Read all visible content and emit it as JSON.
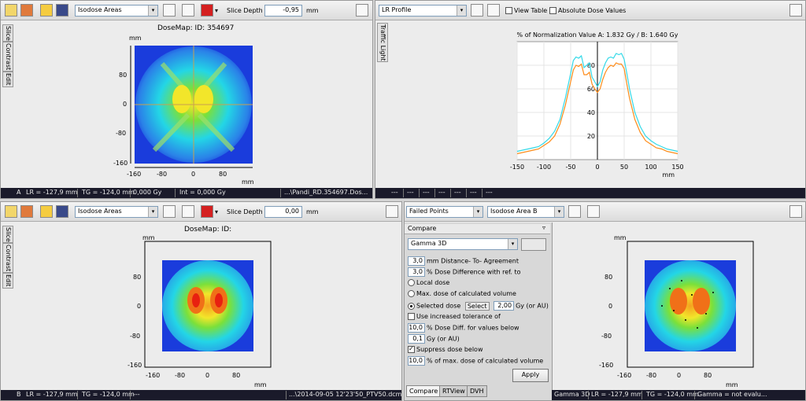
{
  "top_left": {
    "view_select": "Isodose Areas",
    "slice_depth_label": "Slice Depth",
    "slice_depth_value": "-0,95",
    "slice_depth_unit": "mm",
    "vtabs": [
      "Slice",
      "Contrast",
      "Edit"
    ],
    "map_title": "DoseMap: ID: 354697",
    "y_unit": "mm",
    "x_unit": "mm",
    "y_ticks": [
      "80",
      "0",
      "-80",
      "-160"
    ],
    "x_ticks": [
      "-160",
      "-80",
      "0",
      "80"
    ],
    "status": [
      "A",
      "LR = -127,9 mm",
      "TG = -124,0 mm",
      "0,000 Gy",
      "Int = 0,000 Gy",
      "...\\Pandi_RD.354697.Dos..."
    ]
  },
  "top_right": {
    "view_select": "LR Profile",
    "view_table": "View Table",
    "absolute_dose": "Absolute Dose Values",
    "vtab": "Traffic Light",
    "status": [
      "---",
      "---",
      "---",
      "---",
      "---",
      "---",
      "---"
    ]
  },
  "chart_data": {
    "type": "line",
    "title": "% of Normalization Value A: 1.832 Gy  / B: 1.640 Gy",
    "xlabel": "mm",
    "ylabel": "",
    "xlim": [
      -150,
      150
    ],
    "ylim": [
      0,
      100
    ],
    "x_ticks": [
      -150,
      -100,
      -50,
      0,
      50,
      100,
      150
    ],
    "y_ticks": [
      20,
      40,
      60,
      80
    ],
    "series": [
      {
        "color": "#33d9e8",
        "x": [
          -150,
          -140,
          -130,
          -120,
          -110,
          -100,
          -90,
          -80,
          -70,
          -60,
          -50,
          -45,
          -40,
          -35,
          -30,
          -25,
          -20,
          -15,
          -10,
          -5,
          0,
          5,
          10,
          15,
          20,
          25,
          30,
          35,
          40,
          45,
          50,
          55,
          60,
          70,
          80,
          90,
          100,
          110,
          120,
          130,
          140,
          150
        ],
        "y": [
          7,
          8,
          9,
          10,
          11,
          14,
          18,
          24,
          34,
          52,
          73,
          84,
          87,
          86,
          88,
          78,
          80,
          82,
          70,
          66,
          62,
          66,
          76,
          82,
          86,
          87,
          86,
          90,
          89,
          90,
          85,
          73,
          60,
          40,
          28,
          20,
          16,
          13,
          11,
          9,
          8,
          7
        ]
      },
      {
        "color": "#ff8c1a",
        "x": [
          -150,
          -140,
          -130,
          -120,
          -110,
          -100,
          -90,
          -80,
          -70,
          -60,
          -50,
          -45,
          -40,
          -35,
          -30,
          -25,
          -20,
          -15,
          -10,
          -5,
          0,
          5,
          10,
          15,
          20,
          25,
          30,
          35,
          40,
          45,
          50,
          55,
          60,
          70,
          80,
          90,
          100,
          110,
          120,
          130,
          140,
          150
        ],
        "y": [
          5,
          6,
          7,
          8,
          9,
          12,
          15,
          20,
          30,
          46,
          66,
          76,
          80,
          79,
          81,
          72,
          72,
          74,
          64,
          60,
          57,
          60,
          68,
          74,
          78,
          80,
          79,
          82,
          81,
          81,
          77,
          64,
          52,
          34,
          23,
          16,
          13,
          10,
          9,
          7,
          6,
          5
        ]
      }
    ]
  },
  "bottom_left": {
    "view_select": "Isodose Areas",
    "slice_depth_label": "Slice Depth",
    "slice_depth_value": "0,00",
    "slice_depth_unit": "mm",
    "vtabs": [
      "Slice",
      "Contrast",
      "Edit"
    ],
    "map_title": "DoseMap: ID:",
    "y_unit": "mm",
    "x_unit": "mm",
    "y_ticks": [
      "80",
      "0",
      "-80",
      "-160"
    ],
    "x_ticks": [
      "-160",
      "-80",
      "0",
      "80"
    ],
    "status": [
      "B",
      "LR = -127,9 mm",
      "TG = -124,0 mm",
      "---",
      "...\\2014-09-05 12'23'50_PTV50.dcm"
    ]
  },
  "bottom_right": {
    "mode_select": "Failed Points",
    "area_select": "Isodose Area B",
    "panel_title": "Compare",
    "pin": "ᵖ",
    "method_select": "Gamma 3D",
    "distance_value": "3,0",
    "distance_label": "mm Distance- To- Agreement",
    "dose_diff_value": "3,0",
    "dose_diff_label": "% Dose Difference with ref. to",
    "radio_local": "Local dose",
    "radio_max": "Max. dose of calculated volume",
    "radio_selected": "Selected dose",
    "select_button": "Select",
    "selected_value": "2,00",
    "selected_unit": "Gy (or AU)",
    "increased_tolerance": "Use increased tolerance of",
    "tol_dose_value": "10,0",
    "tol_dose_label": "% Dose Diff. for values below",
    "tol_gy_value": "0,1",
    "tol_gy_label": "Gy (or AU)",
    "suppress": "Suppress dose below",
    "suppress_value": "10,0",
    "suppress_label": "% of max. dose of calculated volume",
    "apply": "Apply",
    "tabs": [
      "Compare",
      "RTView",
      "DVH"
    ],
    "y_unit": "mm",
    "x_unit": "mm",
    "y_ticks": [
      "80",
      "0",
      "-80",
      "-160"
    ],
    "x_ticks": [
      "-160",
      "-80",
      "0",
      "80"
    ],
    "status": [
      "Gamma 3D",
      "LR = -127,9 mm",
      "TG = -124,0 mm",
      "Gamma = not evalu..."
    ]
  },
  "colors": {
    "status_bg": "#1a1a2a",
    "dose_blue": "#1a3cdc",
    "dose_cyan": "#23d6e6",
    "dose_green": "#7be03a",
    "dose_yellow": "#f2e62a",
    "dose_red": "#e81818"
  }
}
